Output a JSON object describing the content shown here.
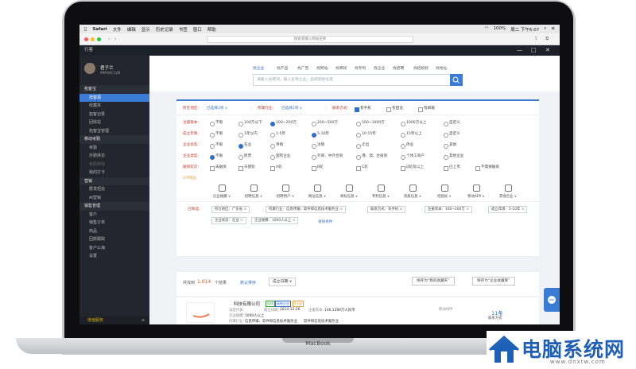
{
  "menubar": {
    "apple_icon": "apple-icon",
    "app": "Safari",
    "items": [
      "文件",
      "编辑",
      "显示",
      "历史记录",
      "书签",
      "窗口",
      "帮助"
    ],
    "battery": "100%",
    "time": "周二 下午6:07"
  },
  "browser": {
    "url": "搜索或输入网站名称"
  },
  "app": {
    "title": "行客",
    "win_min": "—",
    "win_max": "□",
    "win_close": "✕"
  },
  "profile": {
    "name": "君子兰",
    "sub": "MMA的CLUB"
  },
  "sidebar": {
    "items": [
      {
        "label": "拓客宝",
        "type": "group"
      },
      {
        "label": "找客源",
        "type": "active"
      },
      {
        "label": "收藏夹",
        "type": "sub"
      },
      {
        "label": "拓客记录",
        "type": "sub"
      },
      {
        "label": "回收站",
        "type": "sub"
      },
      {
        "label": "拓客宝管理",
        "type": "sub"
      },
      {
        "label": "移动考勤",
        "type": "group"
      },
      {
        "label": "考勤",
        "type": "sub"
      },
      {
        "label": "外勤拜访",
        "type": "sub"
      },
      {
        "label": "考勤规则",
        "type": "dim"
      },
      {
        "label": "我的打卡",
        "type": "sub"
      },
      {
        "label": "营销",
        "type": "group"
      },
      {
        "label": "群发短信",
        "type": "sub"
      },
      {
        "label": "AI营销",
        "type": "sub"
      },
      {
        "label": "销售管理",
        "type": "group"
      },
      {
        "label": "客户",
        "type": "sub"
      },
      {
        "label": "销售订单",
        "type": "sub"
      },
      {
        "label": "商品",
        "type": "sub"
      },
      {
        "label": "回款跟踪",
        "type": "sub"
      },
      {
        "label": "客户公海",
        "type": "sub"
      },
      {
        "label": "设置",
        "type": "sub"
      }
    ],
    "footer": "增值服务",
    "footer_icon": "menu-icon"
  },
  "search": {
    "tabs": [
      "找企业",
      "找产品",
      "找广告",
      "找网站",
      "找商标",
      "找专利",
      "找企业",
      "找招聘",
      "找招投标",
      "找地址"
    ],
    "placeholder": "请输入关键词，输入名称企业，品牌或地址等",
    "button_icon": "search-icon"
  },
  "filters": {
    "top": [
      {
        "label": "所在地区：",
        "value": "已选择1项 ∨"
      },
      {
        "label": "所属行业：",
        "value": "已选择1项 ∨"
      },
      {
        "label": "联系方式：",
        "options": [
          "有手机",
          "有固话",
          "有邮箱"
        ]
      }
    ],
    "rows": [
      {
        "label": "注册资本：",
        "options": [
          "不限",
          "100万以下",
          "100~200万",
          "200~500万",
          "500~1000万",
          "1000万以上",
          "自定义"
        ],
        "selected": 2
      },
      {
        "label": "成立年限：",
        "options": [
          "不限",
          "1年以内",
          "1-5年",
          "5-10年",
          "10-15年",
          "15年以上",
          "自定义"
        ],
        "selected": 3
      },
      {
        "label": "企业状态：",
        "options": [
          "不限",
          "在业",
          "吊销",
          "注销",
          "迁出",
          "停业",
          "其他"
        ],
        "selected": 1
      },
      {
        "label": "企业类型：",
        "options": [
          "不限",
          "民营",
          "国有企业",
          "外资、中外合资",
          "港、澳、台投资",
          "个体工商户",
          "其他企业"
        ],
        "selected": 0
      },
      {
        "label": "融资轮次：",
        "options": [
          "未融资",
          "天使轮",
          "A轮",
          "B轮",
          "C轮",
          "D轮及以上",
          "已上市",
          "不需要融资"
        ],
        "selected": -1
      }
    ],
    "vip_label": "VIP筛选：",
    "vip": [
      {
        "label": "企业规模 ∨",
        "icon": "building-icon"
      },
      {
        "label": "招聘信息 ∨",
        "icon": "people-icon"
      },
      {
        "label": "招聘用户 ∨",
        "icon": "monitor-icon"
      },
      {
        "label": "网址信息 ∨",
        "icon": "globe-icon"
      },
      {
        "label": "商标信息 ∨",
        "icon": "registered-icon"
      },
      {
        "label": "专利信息 ∨",
        "icon": "patent-icon"
      },
      {
        "label": "资质信息 ∨",
        "icon": "heart-icon"
      },
      {
        "label": "招投标 ∨",
        "icon": "bid-icon"
      },
      {
        "label": "移动APP ∨",
        "icon": "phone-icon"
      },
      {
        "label": "其他企业 ∨",
        "icon": "more-icon"
      }
    ],
    "selected_label": "已筛选：",
    "chips": [
      "所在地区：广东省",
      "所属行业：信息传输、软件和信息技术服务业",
      "联系方式：有手机",
      "注册资本：100~200万",
      "成立年限：5-10年",
      "企业状态：在业",
      "企业规模：1000人以上"
    ],
    "clear": "清除条件"
  },
  "results": {
    "prefix": "共找到",
    "count": "1,014",
    "suffix": "个结果",
    "sort_default": "默认排序",
    "sort_option": "成立日期 ∨",
    "save_search": "保存为“我的收藏夹”",
    "save_library": "保存为“企业收藏库”"
  },
  "company": {
    "name": "科技有限公司",
    "tags": [
      "存续",
      "高新企业",
      "A+级"
    ],
    "legal": "法定代表：",
    "founded_label": "成立日期：",
    "founded": "2014-12-26",
    "capital_label": "注册资本：",
    "capital": "146,1289万人民币",
    "scale_label": "企业规模：",
    "scale": "1000人以上",
    "industry_label": "所属行业：",
    "industry": "信息传输、软件和信息技术服务业",
    "scope": "软件和信息技术服务业",
    "address_label": "经营地址：",
    "address": "广州市天河区黄村大道西路15号",
    "mobile_label": "移动APP",
    "contact_count": "11条",
    "contact_label": "联系方式"
  },
  "laptop": {
    "brand": "MacBook"
  },
  "watermark": {
    "title": "电脑系统网",
    "url": "www.dnxtw.com"
  }
}
